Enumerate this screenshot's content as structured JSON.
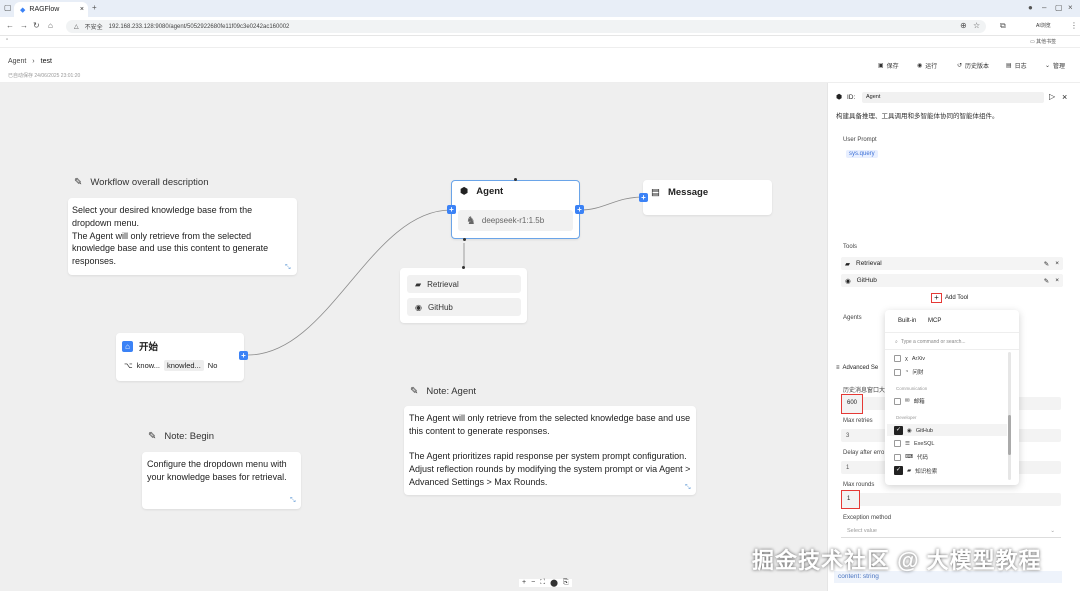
{
  "browser": {
    "tab_title": "RAGFlow",
    "url_warning": "不安全",
    "url": "192.168.233.128:9080/agent/5052922680fe11f09c3e0242ac160002",
    "profile_label": "AI浏览",
    "bookmark_label": "其他书签"
  },
  "header": {
    "crumb_root": "Agent",
    "crumb_current": "test",
    "subtitle": "已自动保存 24/06/2025 23:01:20",
    "buttons": [
      "保存",
      "运行",
      "历史版本",
      "日志",
      "管理"
    ]
  },
  "canvas": {
    "overall_note": {
      "title": "Workflow overall description",
      "body": "Select your desired knowledge base from the dropdown menu.\nThe Agent will only retrieve from the selected knowledge base and use this content  to generate responses."
    },
    "agent_node": {
      "title": "Agent",
      "model": "deepseek-r1:1.5b"
    },
    "message_node": {
      "title": "Message"
    },
    "tools_node": {
      "items": [
        "Retrieval",
        "GitHub"
      ]
    },
    "begin_node": {
      "title": "开始",
      "param_key": "know...",
      "param_value": "knowled...",
      "param_required": "No"
    },
    "note_begin": {
      "title": "Note: Begin",
      "body": "Configure the dropdown menu with your knowledge bases for retrieval."
    },
    "note_agent": {
      "title": "Note: Agent",
      "body": "The Agent will only retrieve from the selected knowledge base and use this content  to generate responses.\n\nThe Agent prioritizes rapid response per system prompt configuration. Adjust reflection rounds by modifying the system prompt or via Agent > Advanced Settings > Max Rounds."
    },
    "zoom_controls": [
      "+",
      "−",
      "⛶",
      "⬤",
      "⎘"
    ]
  },
  "panel": {
    "id_label": "ID:",
    "id_value": "Agent",
    "description": "构建具备推理、工具调用和多智能体协同的智能体组件。",
    "user_prompt_label": "User Prompt",
    "user_prompt_value": "sys.query",
    "tools_label": "Tools",
    "tools": [
      "Retrieval",
      "GitHub"
    ],
    "add_tool_label": "Add Tool",
    "agents_label": "Agents",
    "advanced_label": "Advanced Se",
    "history_label": "历史消息窗口大",
    "history_value": "600",
    "max_retries_label": "Max retries",
    "max_retries_value": "3",
    "delay_label": "Delay after erro",
    "delay_value": "1",
    "max_rounds_label": "Max rounds",
    "max_rounds_value": "1",
    "exception_label": "Exception method",
    "exception_placeholder": "Select value",
    "output_label": "content: string"
  },
  "popup": {
    "tabs": [
      "Built-in",
      "MCP"
    ],
    "search_placeholder": "Type a command or search...",
    "items_top": [
      {
        "label": "ArXiv",
        "checked": false
      },
      {
        "label": "问财",
        "checked": false
      }
    ],
    "group_communication": "Communication",
    "items_comm": [
      {
        "label": "邮箱",
        "checked": false
      }
    ],
    "group_developer": "Developer",
    "items_dev": [
      {
        "label": "GitHub",
        "checked": true
      },
      {
        "label": "ExeSQL",
        "checked": false
      },
      {
        "label": "代码",
        "checked": false
      },
      {
        "label": "知识检索",
        "checked": true
      }
    ]
  },
  "watermark": "掘金技术社区 @ 大模型教程",
  "colors": {
    "accent": "#3b82f6",
    "highlight": "#e53935",
    "canvas": "#efefef"
  }
}
